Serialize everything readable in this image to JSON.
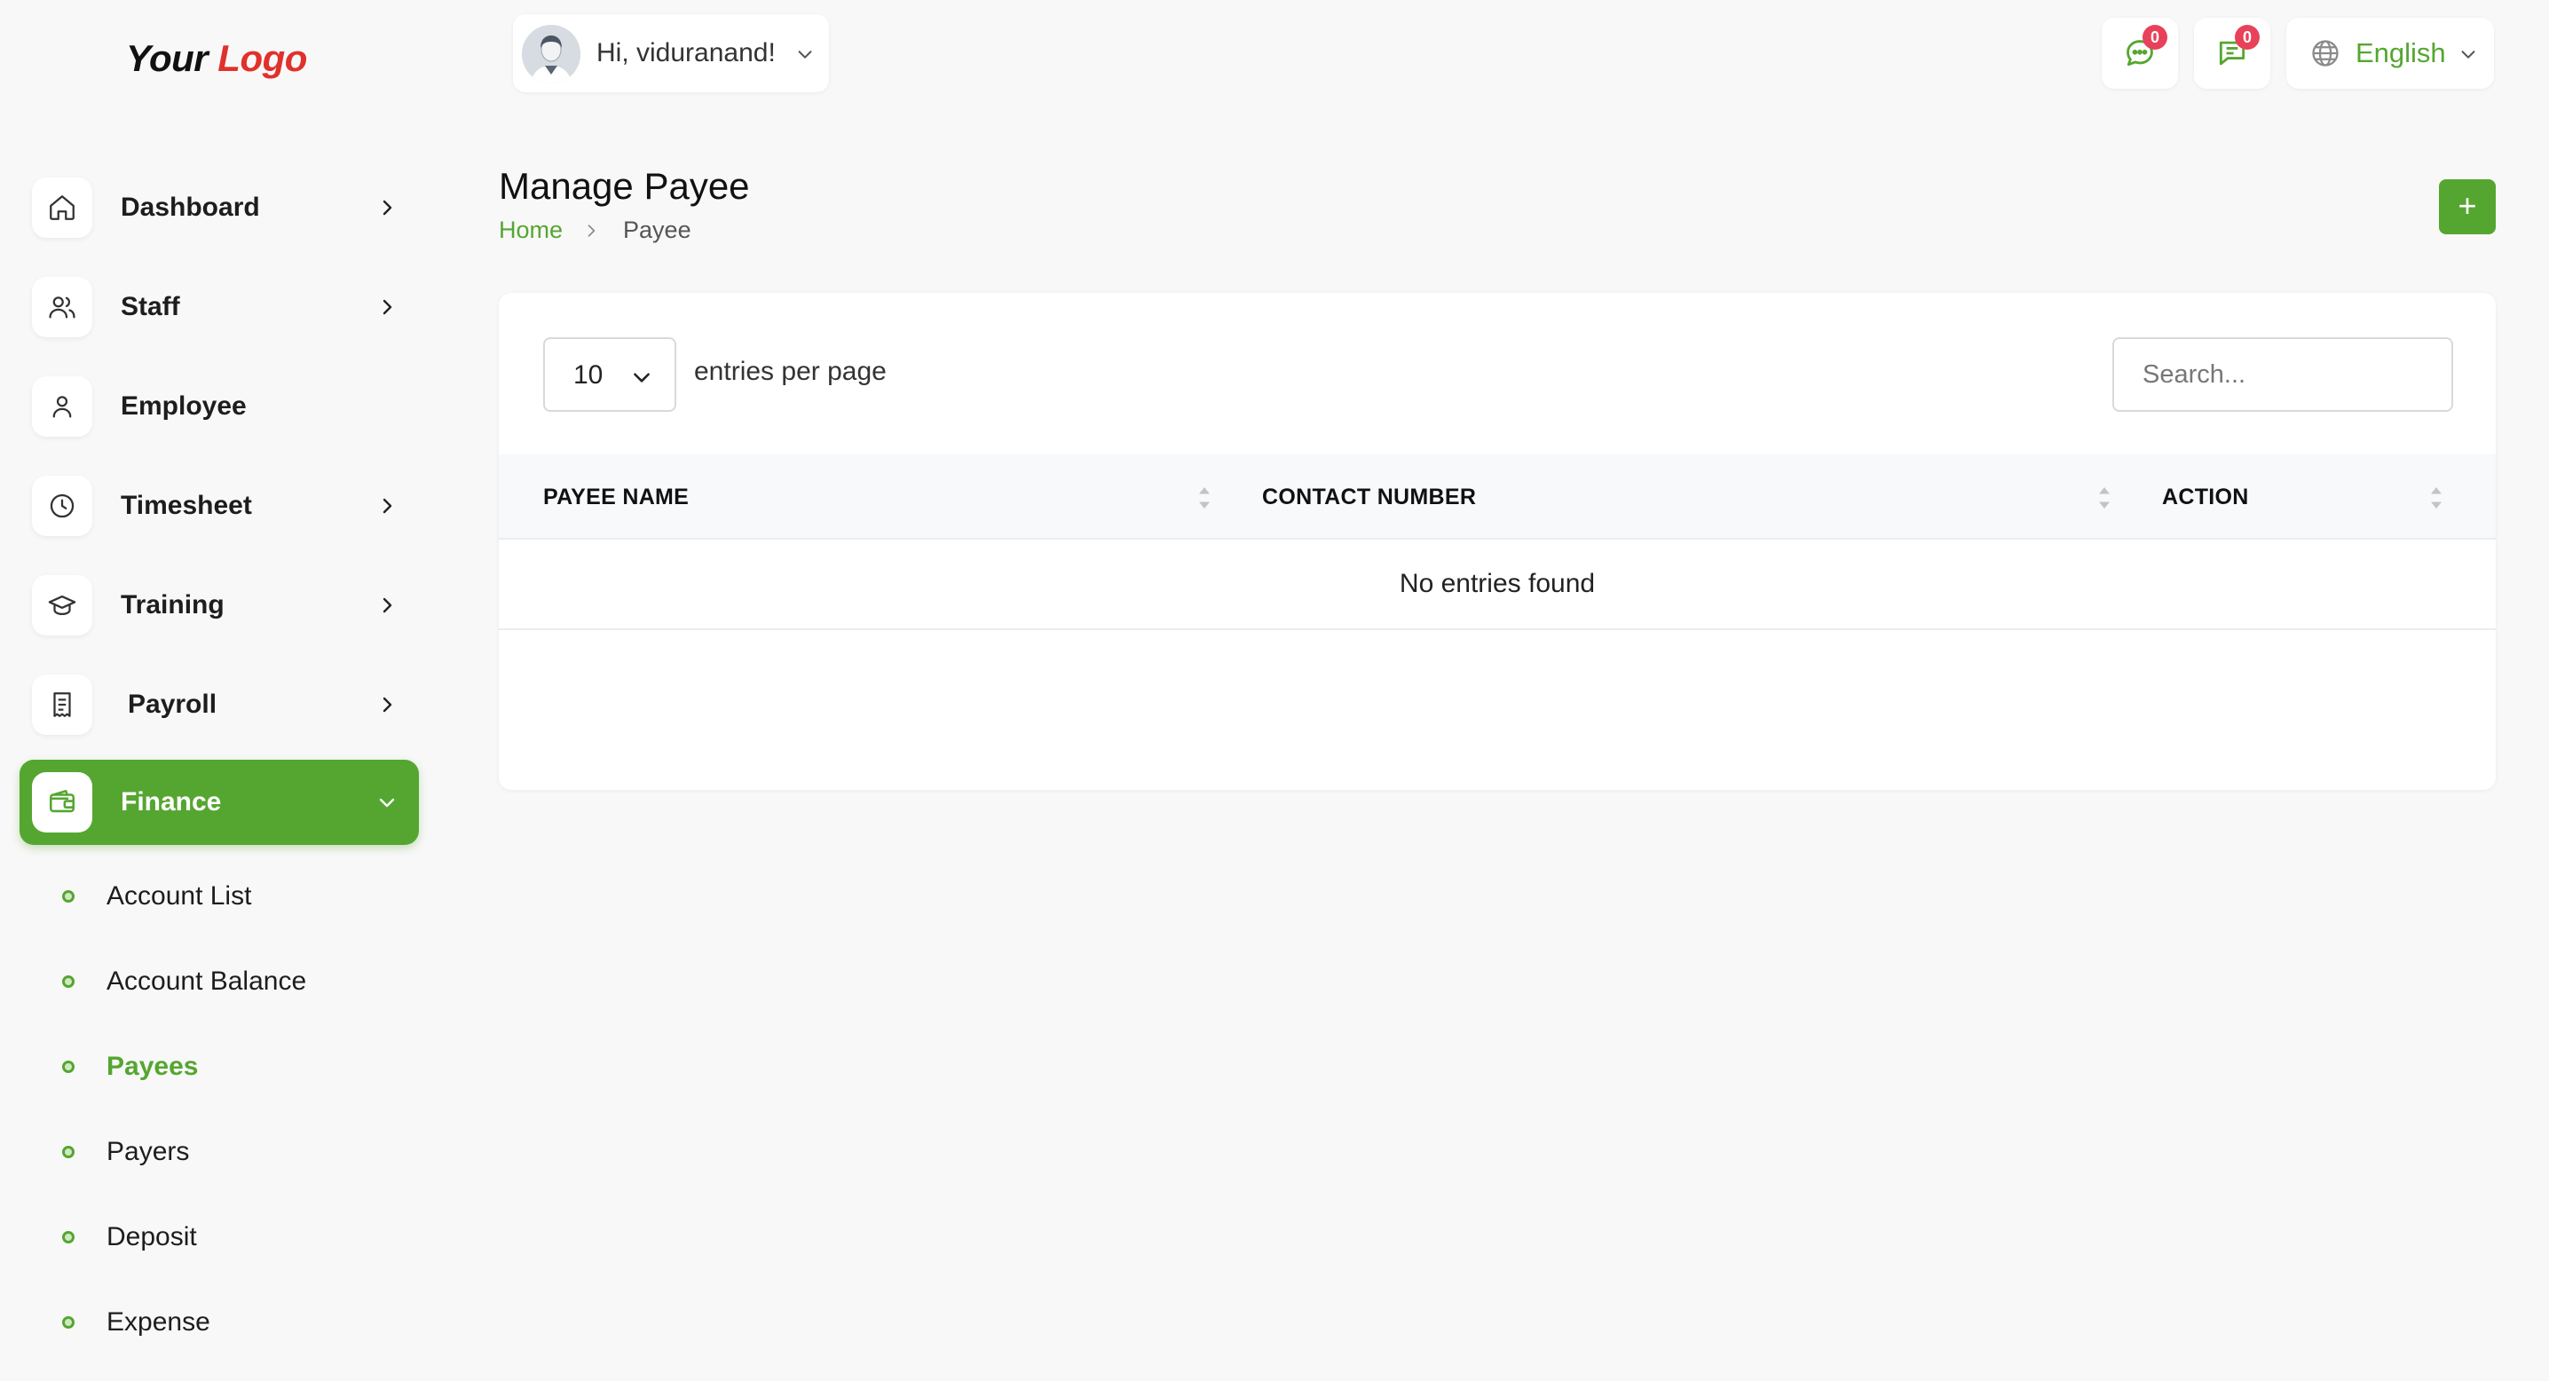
{
  "logo": {
    "word1": "Your",
    "word2": "Logo"
  },
  "topbar": {
    "greeting": "Hi, viduranand!",
    "messages_badge": "0",
    "chat_badge": "0",
    "language": "English"
  },
  "sidebar": {
    "items": [
      {
        "label": "Dashboard",
        "icon": "home-icon"
      },
      {
        "label": "Staff",
        "icon": "users-icon"
      },
      {
        "label": "Employee",
        "icon": "user-icon"
      },
      {
        "label": "Timesheet",
        "icon": "clock-icon"
      },
      {
        "label": "Training",
        "icon": "graduation-cap-icon"
      },
      {
        "label": "Payroll",
        "icon": "receipt-icon"
      },
      {
        "label": "Finance",
        "icon": "wallet-icon"
      }
    ],
    "finance_sub": [
      "Account List",
      "Account Balance",
      "Payees",
      "Payers",
      "Deposit",
      "Expense"
    ]
  },
  "page": {
    "title": "Manage Payee",
    "breadcrumb_home": "Home",
    "breadcrumb_current": "Payee",
    "add_label": "+"
  },
  "table": {
    "per_page_value": "10",
    "per_page_label": "entries per page",
    "search_placeholder": "Search...",
    "columns": [
      "PAYEE NAME",
      "CONTACT NUMBER",
      "ACTION"
    ],
    "empty_message": "No entries found"
  },
  "colors": {
    "accent": "#55a630",
    "logo_red": "#e0312b",
    "badge": "#e8415a"
  }
}
